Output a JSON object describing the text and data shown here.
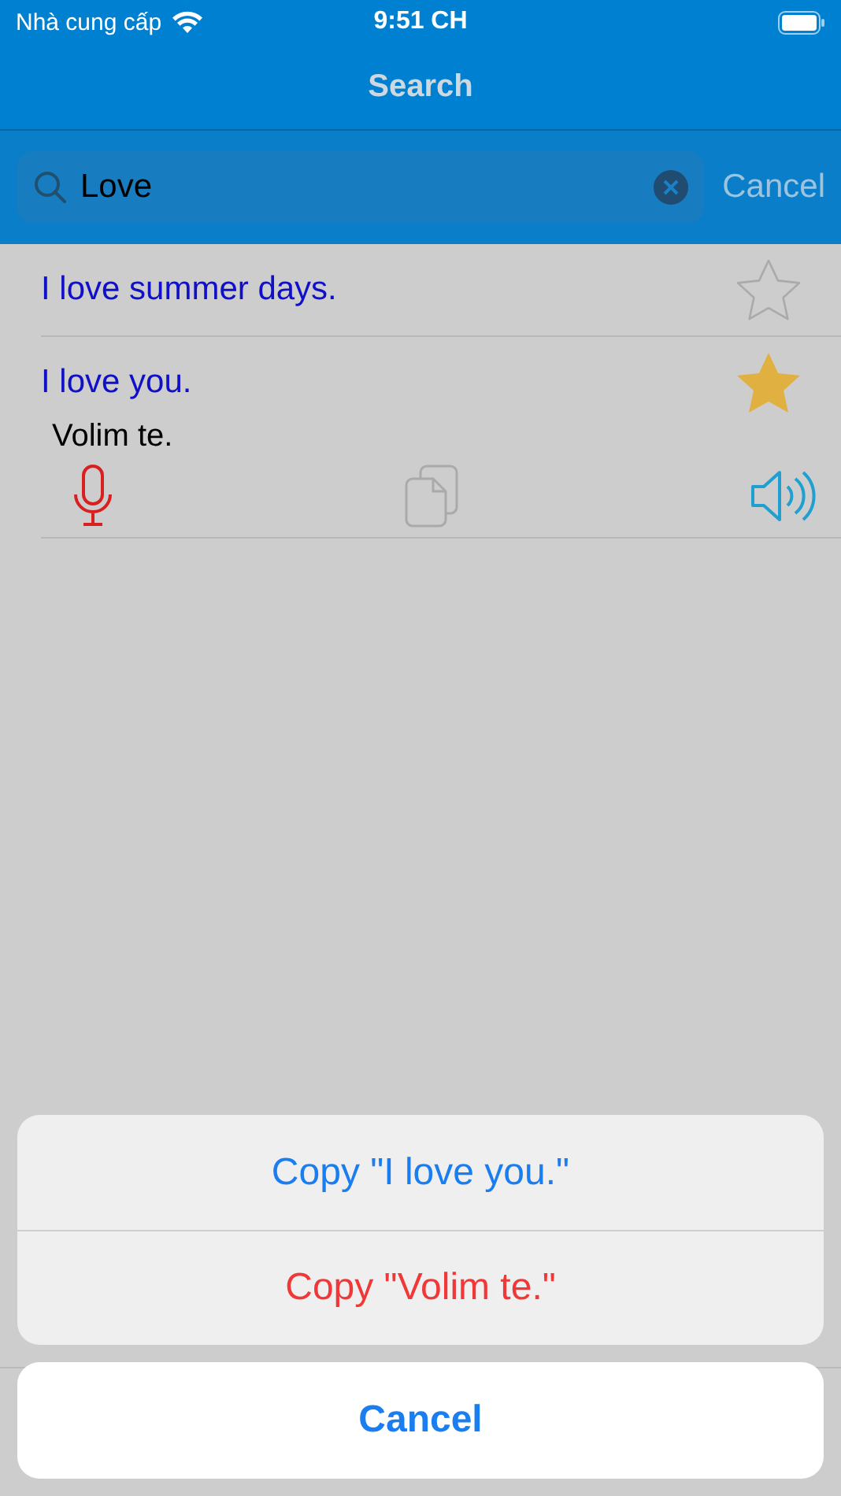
{
  "status_bar": {
    "carrier": "Nhà cung cấp",
    "time": "9:51 CH"
  },
  "nav": {
    "title": "Search"
  },
  "search": {
    "value": "Love",
    "cancel": "Cancel"
  },
  "results": [
    {
      "text": "I love summer days.",
      "favorite": false
    },
    {
      "text": "I love you.",
      "translation": "Volim te.",
      "favorite": true
    }
  ],
  "action_sheet": {
    "actions": [
      {
        "label": "Copy \"I love you.\"",
        "kind": "default"
      },
      {
        "label": "Copy \"Volim te.\"",
        "kind": "destructive"
      }
    ],
    "cancel": "Cancel"
  }
}
